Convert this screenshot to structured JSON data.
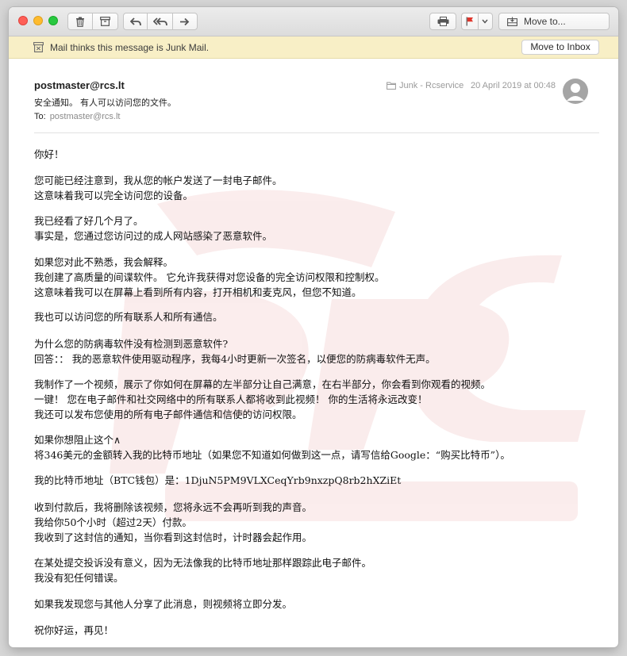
{
  "toolbar": {
    "move_to_label": "Move to..."
  },
  "junk_banner": {
    "message": "Mail thinks this message is Junk Mail.",
    "button_label": "Move to Inbox"
  },
  "header": {
    "sender": "postmaster@rcs.lt",
    "subject": "安全通知。 有人可以访问您的文件。",
    "to_label": "To:",
    "to_value": "postmaster@rcs.lt",
    "mailbox": "Junk - Rcservice",
    "date": "20 April 2019 at 00:48"
  },
  "body": {
    "p1": [
      "你好！"
    ],
    "p2": [
      "您可能已经注意到，我从您的帐户发送了一封电子邮件。",
      "这意味着我可以完全访问您的设备。"
    ],
    "p3": [
      "我已经看了好几个月了。",
      "事实是，您通过您访问过的成人网站感染了恶意软件。"
    ],
    "p4": [
      "如果您对此不熟悉，我会解释。",
      "我创建了高质量的间谍软件。 它允许我获得对您设备的完全访问权限和控制权。",
      "这意味着我可以在屏幕上看到所有内容，打开相机和麦克风，但您不知道。"
    ],
    "p5": [
      "我也可以访问您的所有联系人和所有通信。"
    ],
    "p6": [
      "为什么您的防病毒软件没有检测到恶意软件?",
      "回答：： 我的恶意软件使用驱动程序，我每4小时更新一次签名，以便您的防病毒软件无声。"
    ],
    "p7": [
      "我制作了一个视频，展示了你如何在屏幕的左半部分让自己满意，在右半部分，你会看到你观看的视频。",
      "一键！ 您在电子邮件和社交网络中的所有联系人都将收到此视频！ 你的生活将永远改变！",
      "我还可以发布您使用的所有电子邮件通信和信使的访问权限。"
    ],
    "p8": [
      "如果你想阻止这个∧",
      "将346美元的金额转入我的比特币地址（如果您不知道如何做到这一点，请写信给Google：“购买比特币”）。"
    ],
    "p9": [
      "我的比特币地址（BTC钱包）是：1DjuN5PM9VLXCeqYrb9nxzpQ8rb2hXZiEt"
    ],
    "p10": [
      "收到付款后，我将删除该视频，您将永远不会再听到我的声音。",
      "我给你50个小时（超过2天）付款。",
      "我收到了这封信的通知，当你看到这封信时，计时器会起作用。"
    ],
    "p11": [
      "在某处提交投诉没有意义，因为无法像我的比特币地址那样跟踪此电子邮件。",
      "我没有犯任何错误。"
    ],
    "p12": [
      "如果我发现您与其他人分享了此消息，则视频将立即分发。"
    ],
    "p13": [
      "祝你好运，再见！"
    ]
  }
}
